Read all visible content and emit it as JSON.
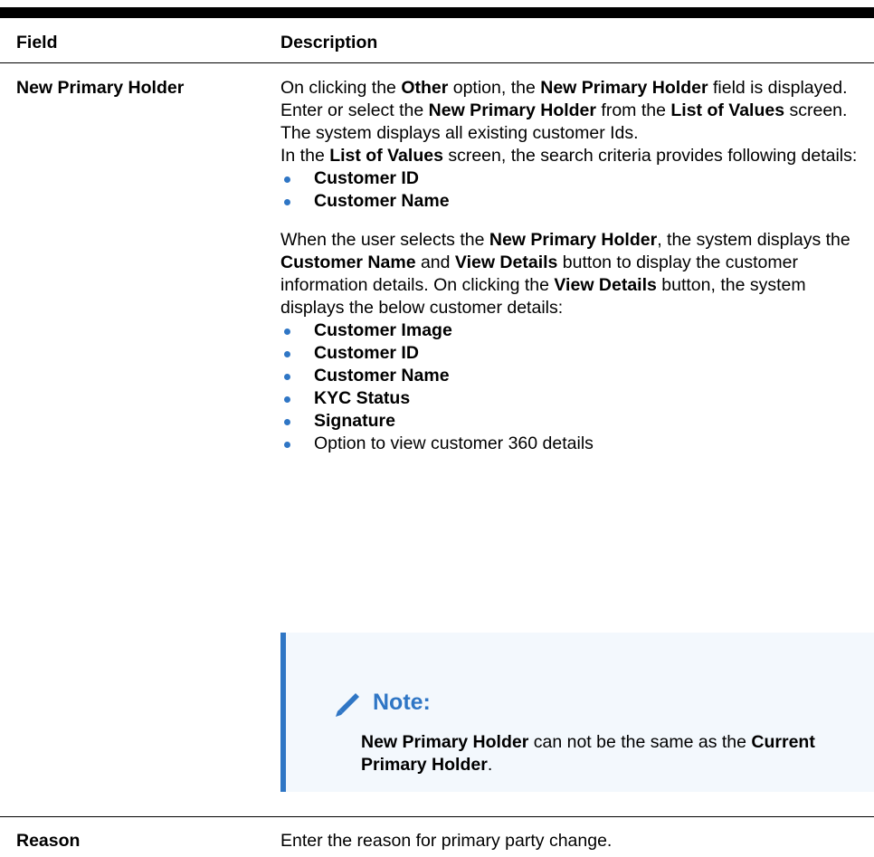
{
  "table": {
    "headers": {
      "field": "Field",
      "description": "Description"
    },
    "rows": [
      {
        "field": "New Primary Holder",
        "p1": {
          "t1": "On clicking the ",
          "b1": "Other",
          "t2": " option, the ",
          "b2": "New Primary Holder",
          "t3": " field is displayed."
        },
        "p2": {
          "t1": "Enter or select the ",
          "b1": "New Primary Holder",
          "t2": " from the ",
          "b2": "List of Values",
          "t3": " screen. The system displays all existing customer Ids."
        },
        "p3": {
          "t1": "In the ",
          "b1": "List of Values",
          "t2": " screen, the search criteria provides following details:"
        },
        "search_criteria": [
          "Customer ID",
          "Customer Name"
        ],
        "p4": {
          "t1": "When the user selects the ",
          "b1": "New Primary Holder",
          "t2": ", the system displays the ",
          "b2": "Customer Name",
          "t3": " and ",
          "b3": "View Details",
          "t4": " button to display the customer information details. On clicking the ",
          "b4": "View Details",
          "t5": " button, the system displays the below customer details:"
        },
        "customer_details": [
          "Customer Image",
          "Customer ID",
          "Customer Name",
          "KYC Status",
          "Signature"
        ],
        "customer_details_extra": "Option to view customer 360 details",
        "note": {
          "icon": "pencil-icon",
          "title": "Note:",
          "b1": "New Primary Holder",
          "t1": " can not be the same as the ",
          "b2": "Current Primary Holder",
          "t2": "."
        }
      },
      {
        "field": "Reason",
        "description": "Enter the reason for primary party change."
      }
    ]
  },
  "colors": {
    "accent": "#2f76c5",
    "note_bg": "#f3f8fd"
  }
}
